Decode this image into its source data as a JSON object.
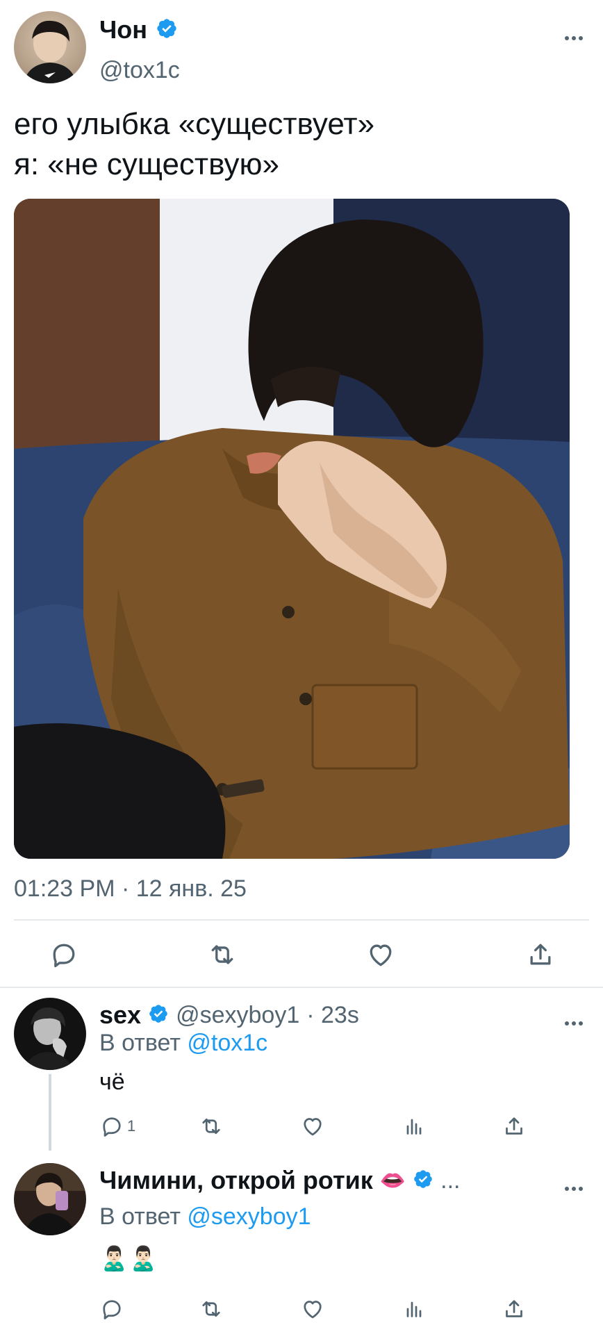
{
  "main_tweet": {
    "display_name": "Чон",
    "handle": "@tox1c",
    "text_line1": "его улыбка «существует»",
    "text_line2": "я: «не существую»",
    "timestamp": "01:23 PM · 12 янв. 25"
  },
  "replies": [
    {
      "display_name": "sex",
      "handle": "@sexyboy1",
      "time": "· 23s",
      "reply_prefix": "В ответ",
      "reply_to": "@tox1c",
      "text": "чё",
      "reply_count": "1"
    },
    {
      "display_name": "Чимини, открой ротик",
      "lips_emoji": "👄",
      "ellipsis": "...",
      "reply_prefix": "В ответ",
      "reply_to": "@sexyboy1",
      "text": "🙎🏻‍♂️🙎🏻‍♂️"
    }
  ],
  "colors": {
    "accent": "#1d9bf0",
    "secondary_text": "#536471",
    "divider": "#e6e9ec"
  },
  "icons": {
    "reply": "speech-bubble-icon",
    "retweet": "retweet-icon",
    "like": "heart-icon",
    "views": "bar-chart-icon",
    "share": "share-upload-icon",
    "verified": "verified-badge-icon",
    "more": "more-dots-icon"
  }
}
